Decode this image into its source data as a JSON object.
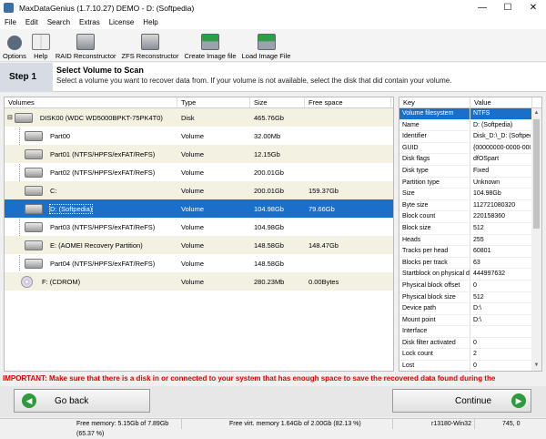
{
  "window": {
    "title": "MaxDataGenius (1.7.10.27) DEMO - D: (Softpedia)",
    "minimize": "—",
    "maximize": "☐",
    "close": "✕"
  },
  "menu": [
    "File",
    "Edit",
    "Search",
    "Extras",
    "License",
    "Help"
  ],
  "toolbar": [
    {
      "label": "Options",
      "icon": "gear-icon",
      "color": "#5b6b7d"
    },
    {
      "label": "Help",
      "icon": "book-icon",
      "color": "#6b6b6b"
    },
    {
      "label": "RAID Reconstructor",
      "icon": "raid-drive-icon",
      "color": "#8a8f98"
    },
    {
      "label": "ZFS Reconstructor",
      "icon": "zfs-drive-icon",
      "color": "#8a8f98"
    },
    {
      "label": "Create Image file",
      "icon": "create-image-icon",
      "color": "#2e9e48"
    },
    {
      "label": "Load Image File",
      "icon": "load-image-icon",
      "color": "#2e9e48"
    }
  ],
  "step": {
    "label": "Step 1",
    "title": "Select Volume to Scan",
    "description": "Select a volume you want to recover data from. If your volume is not available, select the disk that did contain your volume."
  },
  "volumes": {
    "headers": [
      "Volumes",
      "Type",
      "Size",
      "Free space"
    ],
    "rows": [
      {
        "name": "DISK00 (WDC WD5000BPKT-75PK4T0)",
        "type": "Disk",
        "size": "465.76Gb",
        "free": ""
      },
      {
        "name": "Part00",
        "type": "Volume",
        "size": "32.00Mb",
        "free": ""
      },
      {
        "name": "Part01 (NTFS/HPFS/exFAT/ReFS)",
        "type": "Volume",
        "size": "12.15Gb",
        "free": ""
      },
      {
        "name": "Part02 (NTFS/HPFS/exFAT/ReFS)",
        "type": "Volume",
        "size": "200.01Gb",
        "free": ""
      },
      {
        "name": "C:",
        "type": "Volume",
        "size": "200.01Gb",
        "free": "159.37Gb"
      },
      {
        "name": "D: (Softpedia)",
        "type": "Volume",
        "size": "104.98Gb",
        "free": "79.66Gb"
      },
      {
        "name": "Part03 (NTFS/HPFS/exFAT/ReFS)",
        "type": "Volume",
        "size": "104.98Gb",
        "free": ""
      },
      {
        "name": "E: (AOMEI Recovery Partition)",
        "type": "Volume",
        "size": "148.58Gb",
        "free": "148.47Gb"
      },
      {
        "name": "Part04 (NTFS/HPFS/exFAT/ReFS)",
        "type": "Volume",
        "size": "148.58Gb",
        "free": ""
      },
      {
        "name": "F: (CDROM)",
        "type": "Volume",
        "size": "280.23Mb",
        "free": "0.00Bytes"
      }
    ]
  },
  "properties": {
    "headers": [
      "Key",
      "Value"
    ],
    "rows": [
      {
        "k": "Volume filesystem",
        "v": "NTFS"
      },
      {
        "k": "Name",
        "v": "D: (Softpedia)"
      },
      {
        "k": "Identifier",
        "v": "Disk_D:\\_D: (Softped"
      },
      {
        "k": "GUID",
        "v": "{00000000-0000-0000"
      },
      {
        "k": "Disk flags",
        "v": "dfOSpart"
      },
      {
        "k": "Disk type",
        "v": "Fixed"
      },
      {
        "k": "Partition type",
        "v": "Unknown"
      },
      {
        "k": "Size",
        "v": "104.98Gb"
      },
      {
        "k": "Byte size",
        "v": "112721080320"
      },
      {
        "k": "Block count",
        "v": "220158360"
      },
      {
        "k": "Block size",
        "v": "512"
      },
      {
        "k": "Heads",
        "v": "255"
      },
      {
        "k": "Tracks per head",
        "v": "60801"
      },
      {
        "k": "Blocks per track",
        "v": "63"
      },
      {
        "k": "Startblock on physical disk",
        "v": "444997632"
      },
      {
        "k": "Physical block offset",
        "v": "0"
      },
      {
        "k": "Physical block size",
        "v": "512"
      },
      {
        "k": "Device path",
        "v": "D:\\"
      },
      {
        "k": "Mount point",
        "v": "D:\\"
      },
      {
        "k": "Interface",
        "v": ""
      },
      {
        "k": "Disk filter activated",
        "v": "0"
      },
      {
        "k": "Lock count",
        "v": "2"
      },
      {
        "k": "Lost",
        "v": "0"
      }
    ]
  },
  "important": "IMPORTANT: Make sure that there is a disk in or connected to your system that has enough space to save the recovered data found during the",
  "nav": {
    "back": "Go back",
    "continue": "Continue",
    "back_arrow": "◀",
    "continue_arrow": "▶"
  },
  "status": {
    "free_memory": "Free memory: 5.15Gb of 7.89Gb (65.37 %)",
    "free_virt": "Free virt. memory 1.64Gb of 2.00Gb (82.13 %)",
    "build": "r13180-Win32",
    "coords": "745, 0"
  }
}
